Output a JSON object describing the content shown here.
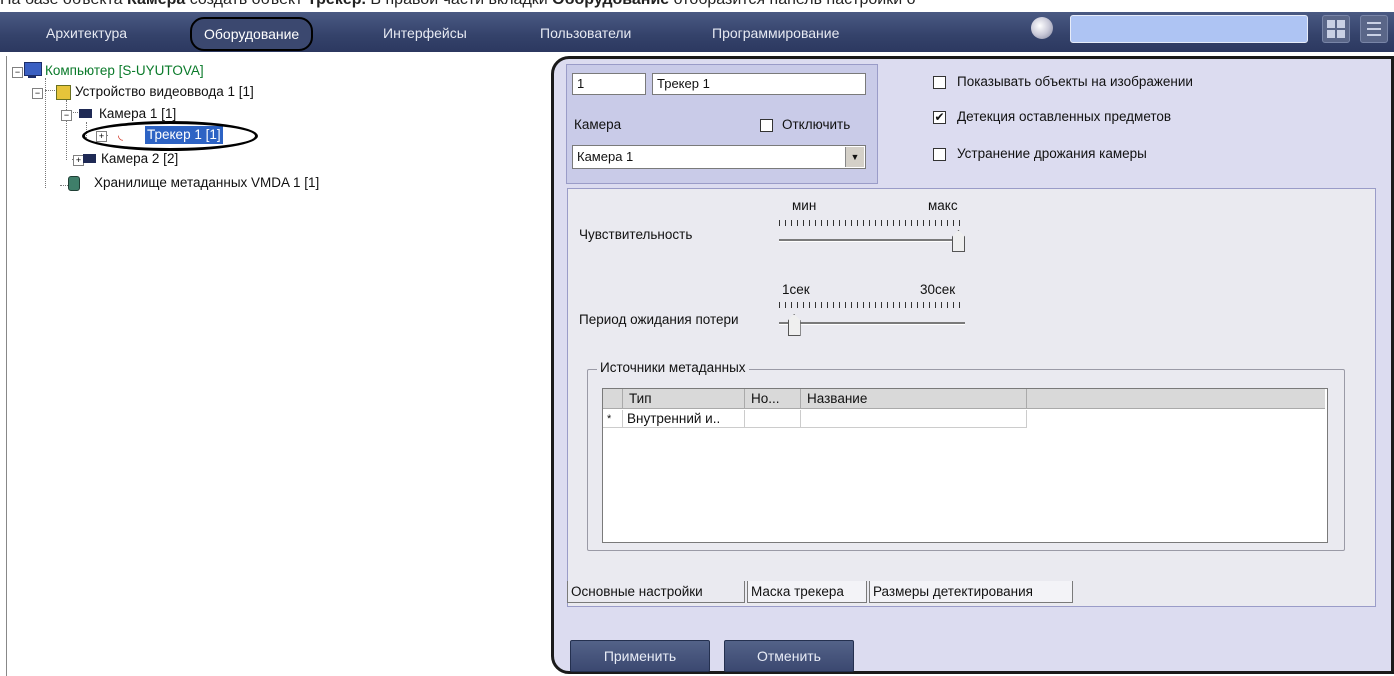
{
  "caption": {
    "p1": "На базе объекта ",
    "b1": "Камера",
    "p2": " создать объект ",
    "b2": "Трекер.",
    "p3": " В правой части вкладки ",
    "b3": "Оборудование",
    "p4": " отобразится панель настройки о"
  },
  "menu": {
    "items": [
      "Архитектура",
      "Оборудование",
      "Интерфейсы",
      "Пользователи",
      "Программирование"
    ],
    "active": "Оборудование",
    "search_value": ""
  },
  "tree": {
    "computer": "Компьютер [S-UYUTOVA]",
    "video_device": "Устройство видеоввода 1 [1]",
    "camera1": "Камера 1 [1]",
    "tracker": "Трекер 1 [1]",
    "camera2": "Камера 2 [2]",
    "storage": "Хранилище метаданных VMDA 1 [1]"
  },
  "panel": {
    "id_value": "1",
    "name_value": "Трекер 1",
    "camera_label": "Камера",
    "disable_label": "Отключить",
    "disable_checked": false,
    "camera_select": "Камера 1",
    "show_objects_label": "Показывать объекты на изображении",
    "show_objects_checked": false,
    "left_items_label": "Детекция оставленных предметов",
    "left_items_checked": true,
    "stabilize_label": "Устранение дрожания камеры",
    "stabilize_checked": false,
    "check_mark": "✔"
  },
  "settings": {
    "sensitivity_label": "Чувствительность",
    "sensitivity_min": "мин",
    "sensitivity_max": "макс",
    "sensitivity_value": 1.0,
    "loss_label": "Период ожидания потери",
    "loss_min": "1сек",
    "loss_max": "30сек",
    "loss_value": 0.05,
    "sources_group": "Источники метаданных",
    "grid": {
      "headers": [
        "Тип",
        "Но...",
        "Название"
      ],
      "rows": [
        {
          "marker": "*",
          "type": "Внутренний и..",
          "num": "",
          "name": ""
        }
      ]
    }
  },
  "tabs": [
    "Основные настройки",
    "Маска трекера",
    "Размеры детектирования"
  ],
  "active_tab": "Основные настройки",
  "buttons": {
    "apply": "Применить",
    "cancel": "Отменить"
  }
}
